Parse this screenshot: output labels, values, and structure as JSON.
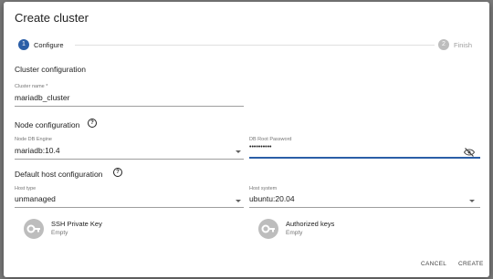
{
  "dialog": {
    "title": "Create cluster"
  },
  "stepper": {
    "steps": [
      {
        "number": "1",
        "label": "Configure"
      },
      {
        "number": "2",
        "label": "Finish"
      }
    ]
  },
  "cluster_config": {
    "heading": "Cluster configuration",
    "name_label": "Cluster name *",
    "name_value": "mariadb_cluster"
  },
  "node_config": {
    "heading": "Node configuration",
    "engine_label": "Node DB Engine",
    "engine_value": "mariadb:10.4",
    "password_label": "DB Root Password",
    "password_value": "••••••••••"
  },
  "host_config": {
    "heading": "Default host configuration",
    "host_type_label": "Host type",
    "host_type_value": "unmanaged",
    "host_system_label": "Host system",
    "host_system_value": "ubuntu:20.04"
  },
  "keys": [
    {
      "name": "SSH Private Key",
      "status": "Empty"
    },
    {
      "name": "Authorized keys",
      "status": "Empty"
    }
  ],
  "actions": {
    "cancel": "CANCEL",
    "create": "CREATE"
  },
  "colors": {
    "primary": "#2b5ea7",
    "inactive_step": "#bdbdbd"
  }
}
